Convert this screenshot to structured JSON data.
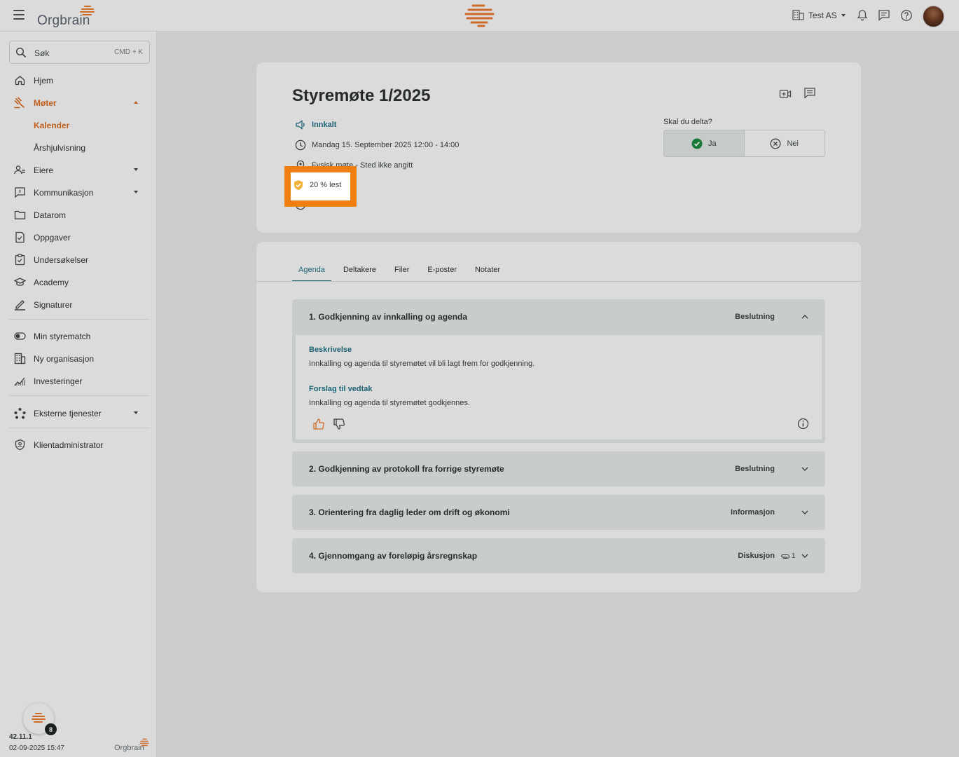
{
  "topbar": {
    "logo_text": "Orgbrain",
    "org_name": "Test AS"
  },
  "sidebar": {
    "search_label": "Søk",
    "search_shortcut": "CMD + K",
    "items": [
      {
        "label": "Hjem",
        "icon": "home-icon"
      },
      {
        "label": "Møter",
        "icon": "gavel-icon"
      },
      {
        "label": "Kalender"
      },
      {
        "label": "Årshjulvisning"
      },
      {
        "label": "Eiere",
        "icon": "owners-icon"
      },
      {
        "label": "Kommunikasjon",
        "icon": "chat-icon"
      },
      {
        "label": "Datarom",
        "icon": "folder-icon"
      },
      {
        "label": "Oppgaver",
        "icon": "task-icon"
      },
      {
        "label": "Undersøkelser",
        "icon": "survey-icon"
      },
      {
        "label": "Academy",
        "icon": "graduation-icon"
      },
      {
        "label": "Signaturer",
        "icon": "signature-icon"
      },
      {
        "label": "Min styrematch",
        "icon": "toggle-icon"
      },
      {
        "label": "Ny organisasjon",
        "icon": "building-icon"
      },
      {
        "label": "Investeringer",
        "icon": "chart-icon"
      },
      {
        "label": "Eksterne tjenester",
        "icon": "network-icon"
      },
      {
        "label": "Klientadministrator",
        "icon": "shield-icon"
      }
    ],
    "fab_badge": "8",
    "version": "42.11.1",
    "build_date": "02-09-2025 15:47",
    "footer_logo_text": "Orgbrain"
  },
  "meeting": {
    "title": "Styremøte 1/2025",
    "status": "Innkalt",
    "datetime": "Mandag 15. September 2025 12:00 - 14:00",
    "location_partial": "Fysisk møte - Sted ikke angitt",
    "read_status": "20 % lest",
    "attend_question": "Skal du delta?",
    "attend_yes": "Ja",
    "attend_no": "Nei"
  },
  "tabs": [
    "Agenda",
    "Deltakere",
    "Filer",
    "E-poster",
    "Notater"
  ],
  "agenda": [
    {
      "title": "1. Godkjenning av innkalling og agenda",
      "type": "Beslutning",
      "expanded": true,
      "description_label": "Beskrivelse",
      "description": "Innkalling og agenda til styremøtet vil bli lagt frem for godkjenning.",
      "proposal_label": "Forslag til vedtak",
      "proposal": "Innkalling og agenda til styremøtet godkjennes."
    },
    {
      "title": "2. Godkjenning av protokoll fra forrige styremøte",
      "type": "Beslutning"
    },
    {
      "title": "3. Orientering fra daglig leder om drift og økonomi",
      "type": "Informasjon"
    },
    {
      "title": "4. Gjennomgang av foreløpig årsregnskap",
      "type": "Diskusjon",
      "attachments": "1"
    }
  ],
  "colors": {
    "accent_orange": "#f07f12",
    "teal": "#1f6f82",
    "active_nav": "#d86a1e"
  }
}
